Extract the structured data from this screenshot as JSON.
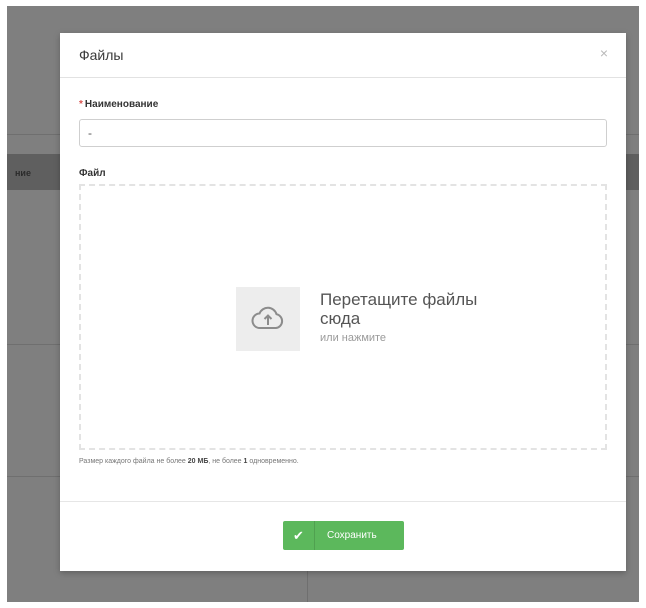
{
  "background": {
    "table_header_fragment": "ние"
  },
  "modal": {
    "title": "Файлы",
    "close_glyph": "×",
    "name_field": {
      "required_mark": "*",
      "label": "Наименование",
      "value": "-"
    },
    "file_field": {
      "label": "Файл"
    },
    "dropzone": {
      "title": "Перетащите файлы сюда",
      "subtitle": "или нажмите",
      "icon": "cloud-upload-icon"
    },
    "hint": {
      "prefix": "Размер каждого файла не более ",
      "size": "20 МБ",
      "middle": ", не более ",
      "count": "1",
      "suffix": " одновременно."
    },
    "save_button": {
      "label": "Сохранить",
      "icon": "check-icon"
    }
  },
  "colors": {
    "overlay": "#7f7f7f",
    "save_button": "#5cb85c",
    "required": "#d9534f"
  }
}
